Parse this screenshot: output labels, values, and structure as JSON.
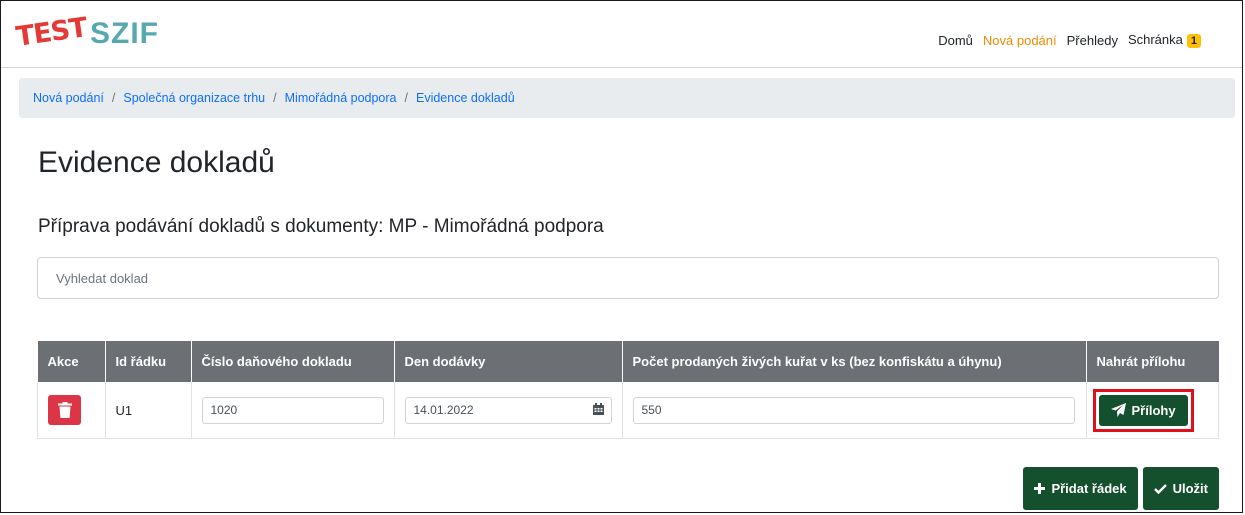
{
  "header": {
    "logo_test": "TEST",
    "logo_brand": "SZIF",
    "nav": [
      {
        "label": "Domů",
        "active": false
      },
      {
        "label": "Nová podání",
        "active": true
      },
      {
        "label": "Přehledy",
        "active": false
      },
      {
        "label": "Schránka",
        "active": false
      }
    ],
    "inbox_count": "1"
  },
  "breadcrumb": [
    "Nová podání",
    "Společná organizace trhu",
    "Mimořádná podpora",
    "Evidence dokladů"
  ],
  "page": {
    "title": "Evidence dokladů",
    "subtitle": "Příprava podávání dokladů s dokumenty: MP - Mimořádná podpora"
  },
  "search": {
    "placeholder": "Vyhledat doklad",
    "value": ""
  },
  "table": {
    "columns": [
      "Akce",
      "Id řádku",
      "Číslo daňového dokladu",
      "Den dodávky",
      "Počet prodaných živých kuřat v ks (bez konfiskátu a úhynu)",
      "Nahrát přílohu"
    ],
    "rows": [
      {
        "id": "U1",
        "doc_number": "1020",
        "delivery_date": "14.01.2022",
        "count": "550",
        "upload_label": "Přílohy"
      }
    ]
  },
  "actions": {
    "add_row": "Přidat řádek",
    "save": "Uložit"
  },
  "colors": {
    "primary": "#14502d",
    "danger": "#dc3545",
    "link": "#0d6efd",
    "accent_nav": "#f08b00",
    "highlight_border": "#e0101a"
  }
}
